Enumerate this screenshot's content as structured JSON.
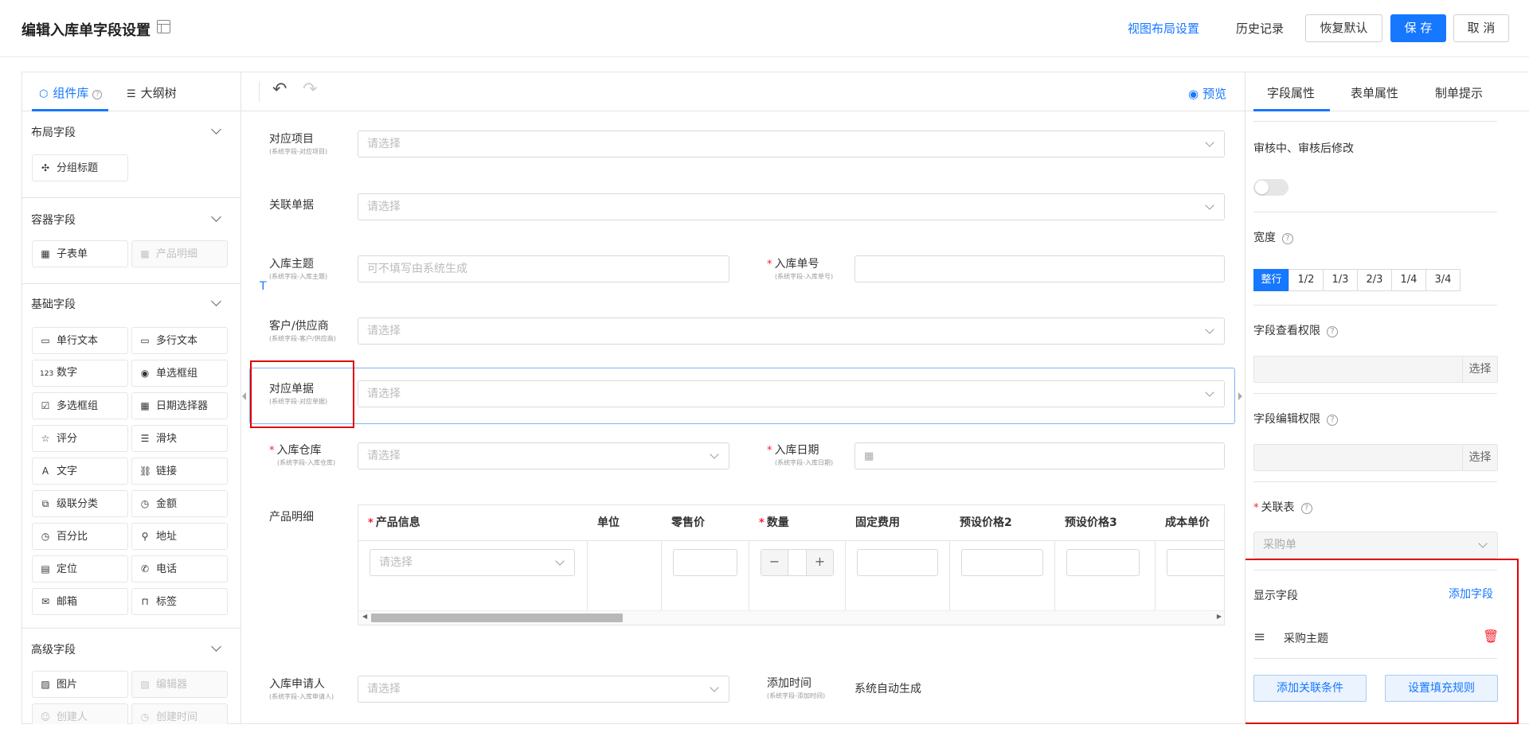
{
  "header": {
    "title": "编辑入库单字段设置",
    "view_layout": "视图布局设置",
    "history": "历史记录",
    "restore": "恢复默认",
    "save": "保 存",
    "cancel": "取 消"
  },
  "left": {
    "tabs": [
      "组件库",
      "大纲树"
    ],
    "sections": {
      "layout": {
        "title": "布局字段",
        "items": [
          "分组标题"
        ]
      },
      "container": {
        "title": "容器字段",
        "items": [
          "子表单",
          "产品明细"
        ]
      },
      "basic": {
        "title": "基础字段",
        "items": [
          "单行文本",
          "多行文本",
          "数字",
          "单选框组",
          "多选框组",
          "日期选择器",
          "评分",
          "滑块",
          "文字",
          "链接",
          "级联分类",
          "金额",
          "百分比",
          "地址",
          "定位",
          "电话",
          "邮箱",
          "标签"
        ]
      },
      "advanced": {
        "title": "高级字段",
        "items": [
          "图片",
          "编辑器",
          "创建人",
          "创建时间"
        ]
      }
    }
  },
  "center": {
    "preview": "预览",
    "placeholder_select": "请选择",
    "fields": {
      "project": {
        "label": "对应项目",
        "sub": "(系统字段-对应项目)"
      },
      "related": {
        "label": "关联单据"
      },
      "subject": {
        "label": "入库主题",
        "sub": "(系统字段-入库主题)",
        "placeholder": "可不填写由系统生成"
      },
      "number": {
        "label": "入库单号",
        "sub": "(系统字段-入库单号)"
      },
      "customer": {
        "label": "客户/供应商",
        "sub": "(系统字段-客户/供应商)"
      },
      "document": {
        "label": "对应单据",
        "sub": "(系统字段-对应单据)"
      },
      "warehouse": {
        "label": "入库仓库",
        "sub": "(系统字段-入库仓库)"
      },
      "date": {
        "label": "入库日期",
        "sub": "(系统字段-入库日期)"
      },
      "product": {
        "label": "产品明细"
      },
      "applicant": {
        "label": "入库申请人",
        "sub": "(系统字段-入库申请人)"
      },
      "added_time": {
        "label": "添加时间",
        "sub": "(系统字段-添加时间)",
        "value": "系统自动生成"
      }
    },
    "table_columns": [
      "产品信息",
      "单位",
      "零售价",
      "数量",
      "固定费用",
      "预设价格2",
      "预设价格3",
      "成本单价"
    ],
    "stepper": {
      "minus": "−",
      "plus": "+"
    }
  },
  "right": {
    "tabs": [
      "字段属性",
      "表单属性",
      "制单提示"
    ],
    "edit_after_review": "审核中、审核后修改",
    "width_label": "宽度",
    "width_options": [
      "整行",
      "1/2",
      "1/3",
      "2/3",
      "1/4",
      "3/4"
    ],
    "width_selected": "整行",
    "view_perm": "字段查看权限",
    "edit_perm": "字段编辑权限",
    "select_btn": "选择",
    "relation_table": "关联表",
    "relation_value": "采购单",
    "display_fields": "显示字段",
    "add_field": "添加字段",
    "display_items": [
      "采购主题"
    ],
    "add_condition": "添加关联条件",
    "fill_rule": "设置填充规则"
  },
  "colors": {
    "accent": "#1677ff",
    "danger": "#f5222d",
    "highlight": "#e00000"
  }
}
